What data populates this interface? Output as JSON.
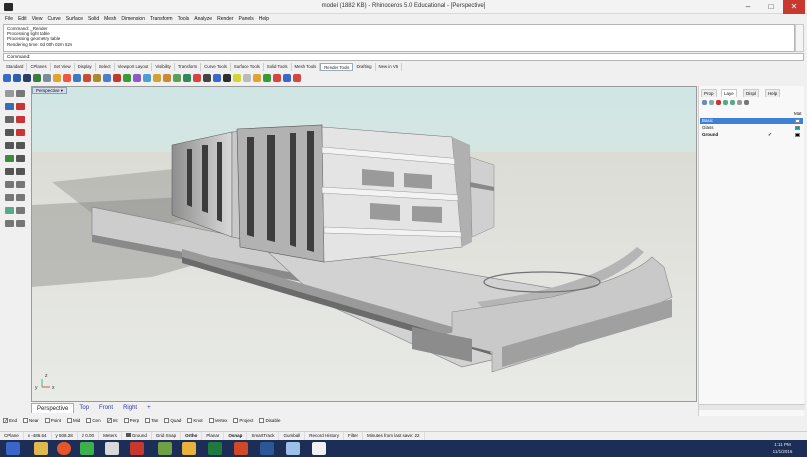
{
  "window": {
    "title": "model (1882 KB) - Rhinoceros 5.0 Educational - [Perspective]",
    "min_glyph": "–",
    "max_glyph": "□",
    "close_glyph": "✕"
  },
  "menu": [
    "File",
    "Edit",
    "View",
    "Curve",
    "Surface",
    "Solid",
    "Mesh",
    "Dimension",
    "Transform",
    "Tools",
    "Analyze",
    "Render",
    "Panels",
    "Help"
  ],
  "command_history": [
    "Command: _Render",
    "Processing light table",
    "Processing geometry table",
    "Rendering time: 0d 00h 02m 52s"
  ],
  "command_prompt": "Command:",
  "toolbar_tabs": [
    {
      "label": "Standard",
      "active": false
    },
    {
      "label": "CPlanes",
      "active": false
    },
    {
      "label": "Set View",
      "active": false
    },
    {
      "label": "Display",
      "active": false
    },
    {
      "label": "Select",
      "active": false
    },
    {
      "label": "Viewport Layout",
      "active": false
    },
    {
      "label": "Visibility",
      "active": false
    },
    {
      "label": "Transform",
      "active": false
    },
    {
      "label": "Curve Tools",
      "active": false
    },
    {
      "label": "Surface Tools",
      "active": false
    },
    {
      "label": "Solid Tools",
      "active": false
    },
    {
      "label": "Mesh Tools",
      "active": false
    },
    {
      "label": "Render Tools",
      "active": true
    },
    {
      "label": "Drafting",
      "active": false
    },
    {
      "label": "New in V5",
      "active": false
    }
  ],
  "viewport": {
    "label": "Perspective ▾",
    "axis_x": "x",
    "axis_y": "y",
    "axis_z": "z"
  },
  "view_tabs": [
    {
      "label": "Perspective",
      "active": true
    },
    {
      "label": "Top",
      "active": false
    },
    {
      "label": "Front",
      "active": false
    },
    {
      "label": "Right",
      "active": false
    },
    {
      "label": "+",
      "active": false
    }
  ],
  "panel": {
    "tabs": [
      "Prop",
      "Laye",
      "Displ",
      "Help"
    ],
    "header_right": "Mat",
    "layers": [
      {
        "name": "Basic",
        "selected": true,
        "swatch": "#ffffff"
      },
      {
        "name": "Glass",
        "selected": false,
        "swatch": "#00a88a"
      },
      {
        "name": "Ground",
        "selected": false,
        "swatch": "#000000",
        "current": "✓"
      }
    ]
  },
  "osnaps": [
    {
      "label": "End",
      "checked": true
    },
    {
      "label": "Near",
      "checked": false
    },
    {
      "label": "Point",
      "checked": false
    },
    {
      "label": "Mid",
      "checked": false
    },
    {
      "label": "Cen",
      "checked": false
    },
    {
      "label": "Int",
      "checked": true
    },
    {
      "label": "Perp",
      "checked": false
    },
    {
      "label": "Tan",
      "checked": false
    },
    {
      "label": "Quad",
      "checked": false
    },
    {
      "label": "Knot",
      "checked": false
    },
    {
      "label": "Vertex",
      "checked": false
    },
    {
      "label": "Project",
      "checked": false
    },
    {
      "label": "Disable",
      "checked": false
    }
  ],
  "status": {
    "cplane": "CPlane",
    "x": "x -486.64",
    "y": "y 508.28",
    "z": "z 0.00",
    "units": "Meters",
    "layer": "Ground",
    "grid_snap": "Grid Snap",
    "ortho": "Ortho",
    "planar": "Planar",
    "osnap": "Osnap",
    "smarttrack": "SmartTrack",
    "gumball": "Gumball",
    "record_history": "Record History",
    "filter": "Filter",
    "minutes": "Minutes from last save: 22"
  },
  "clock": {
    "time": "1:11 PM",
    "date": "11/1/2016"
  },
  "colors": {
    "sky": "#cfe6e4",
    "ground": "#ddddd8",
    "selected_layer": "#3f7fd6",
    "taskbar": "#1c2d56",
    "close": "#c8382f"
  }
}
